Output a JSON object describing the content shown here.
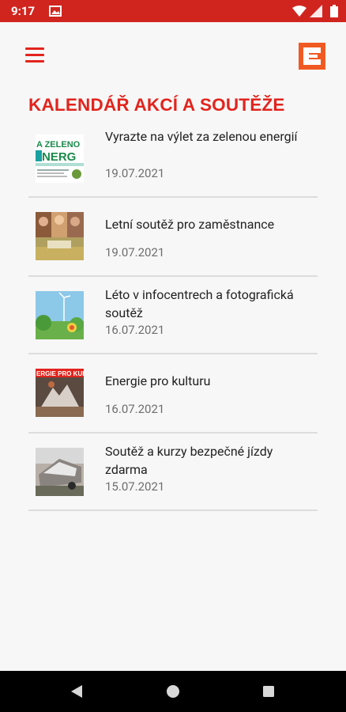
{
  "status_bar": {
    "time": "9:17"
  },
  "page": {
    "title": "KALENDÁŘ AKCÍ A SOUTĚŽE"
  },
  "articles": [
    {
      "title": "Vyrazte na výlet za zelenou energií",
      "date": "19.07.2021",
      "thumb_text": "A ZELENO",
      "thumb_text2": "NERG"
    },
    {
      "title": "Letní soutěž pro zaměstnance",
      "date": "19.07.2021"
    },
    {
      "title": "Léto v infocentrech a fotografická soutěž",
      "date": "16.07.2021"
    },
    {
      "title": "Energie pro kulturu",
      "date": "16.07.2021",
      "thumb_text": "ERGIE PRO KULTUR"
    },
    {
      "title": "Soutěž a kurzy bezpečné jízdy zdarma",
      "date": "15.07.2021"
    }
  ],
  "colors": {
    "accent": "#e2241d",
    "status_bar": "#d0251f"
  },
  "icons": {
    "menu": "hamburger-menu-icon",
    "logo": "cez-logo-icon",
    "back": "back-triangle-icon",
    "home": "home-circle-icon",
    "recents": "recents-square-icon"
  }
}
